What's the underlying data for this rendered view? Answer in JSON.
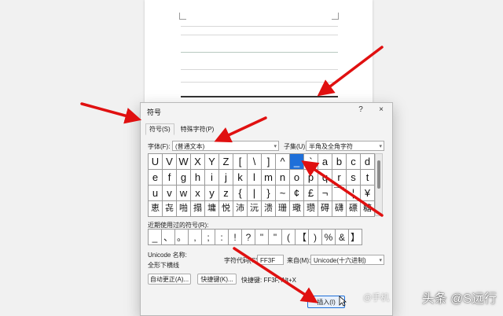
{
  "dialog": {
    "title": "符号",
    "help": "?",
    "close": "×",
    "tabs": [
      {
        "label": "符号(S)"
      },
      {
        "label": "特殊字符(P)"
      }
    ],
    "font_label": "字体(F):",
    "font_value": "(普通文本)",
    "subset_label": "子集(U):",
    "subset_value": "半角及全角字符",
    "grid": [
      [
        "U",
        "V",
        "W",
        "X",
        "Y",
        "Z",
        "[",
        "\\",
        "]",
        "^",
        "_",
        "`",
        "a",
        "b",
        "c",
        "d"
      ],
      [
        "e",
        "f",
        "g",
        "h",
        "i",
        "j",
        "k",
        "l",
        "m",
        "n",
        "o",
        "p",
        "q",
        "r",
        "s",
        "t"
      ],
      [
        "u",
        "v",
        "w",
        "x",
        "y",
        "z",
        "{",
        "|",
        "}",
        "~",
        "¢",
        "£",
        "¬",
        "￣",
        "¦",
        "¥"
      ],
      [
        "恵",
        "㐂",
        "啪",
        "搨",
        "墉",
        "悦",
        "沛",
        "沅",
        "溃",
        "珊",
        "璥",
        "瓒",
        "碍",
        "礴",
        "磦",
        "糖"
      ]
    ],
    "selected": {
      "row": 0,
      "col": 10
    },
    "recent_label": "近期使用过的符号(R):",
    "recent": [
      "_",
      "、",
      "。",
      ",",
      ";",
      ":",
      "!",
      "?",
      "\"",
      "\"",
      "(",
      "【",
      ")",
      "%",
      "&",
      "】"
    ],
    "unicode_name_label": "Unicode 名称:",
    "unicode_name": "全形下横线",
    "char_code_label": "字符代码(C):",
    "char_code_value": "FF3F",
    "from_label": "来自(M):",
    "from_value": "Unicode(十六进制)",
    "autocorrect_button": "自动更正(A)...",
    "shortcut_button": "快捷键(K)...",
    "shortcut_text": "快捷键: FF3F, Alt+X",
    "insert_button": "插入(I)"
  },
  "watermark": {
    "text": "头条 @S远行",
    "sub": "@手机"
  }
}
